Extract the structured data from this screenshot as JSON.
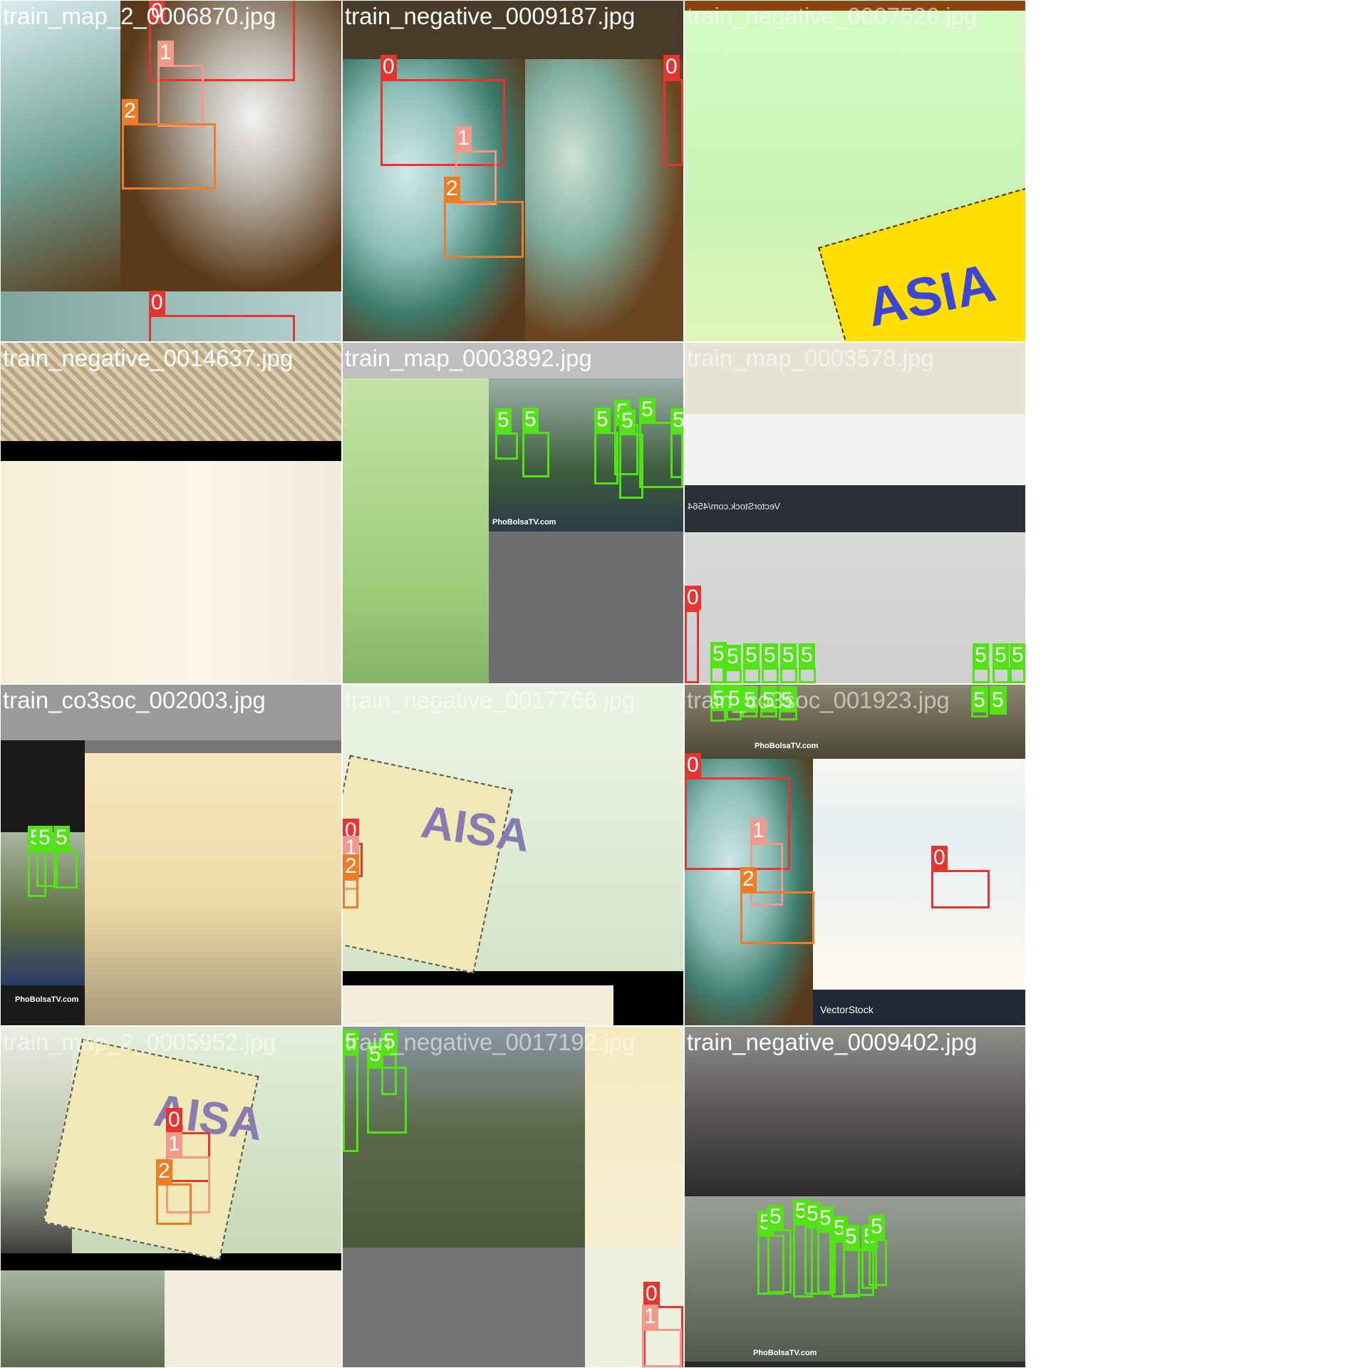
{
  "class_colors": {
    "0": "#e8342e",
    "1": "#f3998c",
    "2": "#f07c25",
    "5": "#52e314"
  },
  "tiles": [
    {
      "filename": "train_map_2_0006870.jpg",
      "boxes": [
        {
          "label": "0"
        },
        {
          "label": "1"
        },
        {
          "label": "2"
        },
        {
          "label": "0"
        }
      ]
    },
    {
      "filename": "train_negative_0009187.jpg",
      "boxes": [
        {
          "label": "0"
        },
        {
          "label": "1"
        },
        {
          "label": "2"
        },
        {
          "label": "0"
        }
      ]
    },
    {
      "filename": "train_negative_0007526.jpg",
      "texts": {
        "sign": "ASIA"
      },
      "boxes": []
    },
    {
      "filename": "train_negative_0014637.jpg",
      "boxes": []
    },
    {
      "filename": "train_map_0003892.jpg",
      "texts": {
        "watermark": "PhoBolsaTV.com"
      },
      "boxes": [
        {
          "label": "5"
        },
        {
          "label": "5"
        },
        {
          "label": "5"
        },
        {
          "label": "5"
        },
        {
          "label": "5"
        },
        {
          "label": "5"
        },
        {
          "label": "5"
        }
      ]
    },
    {
      "filename": "train_map_0003578.jpg",
      "texts": {
        "banner": "VectorStock.com/4564"
      },
      "boxes": [
        {
          "label": "0"
        },
        {
          "label": "5"
        },
        {
          "label": "5"
        },
        {
          "label": "5"
        },
        {
          "label": "5"
        },
        {
          "label": "5"
        },
        {
          "label": "5"
        },
        {
          "label": "5"
        },
        {
          "label": "5"
        },
        {
          "label": "5"
        }
      ]
    },
    {
      "filename": "train_co3soc_002003.jpg",
      "texts": {
        "watermark": "PhoBolsaTV.com"
      },
      "boxes": [
        {
          "label": "5"
        },
        {
          "label": "5"
        },
        {
          "label": "5"
        }
      ]
    },
    {
      "filename": "train_negative_0017766.jpg",
      "texts": {
        "sign": "AISA"
      },
      "boxes": [
        {
          "label": "0"
        },
        {
          "label": "1"
        },
        {
          "label": "2"
        }
      ]
    },
    {
      "filename": "train_co3soc_001923.jpg",
      "texts": {
        "watermark": "PhoBolsaTV.com",
        "vectorstock": "VectorStock"
      },
      "boxes": [
        {
          "label": "5"
        },
        {
          "label": "5"
        },
        {
          "label": "5"
        },
        {
          "label": "5"
        },
        {
          "label": "5"
        },
        {
          "label": "5"
        },
        {
          "label": "5"
        },
        {
          "label": "0"
        },
        {
          "label": "1"
        },
        {
          "label": "2"
        },
        {
          "label": "0"
        }
      ]
    },
    {
      "filename": "train_map_2_0005952.jpg",
      "texts": {
        "sign": "AISA"
      },
      "boxes": [
        {
          "label": "0"
        },
        {
          "label": "1"
        },
        {
          "label": "2"
        }
      ]
    },
    {
      "filename": "train_negative_0017192.jpg",
      "boxes": [
        {
          "label": "5"
        },
        {
          "label": "5"
        },
        {
          "label": "5"
        },
        {
          "label": "0"
        },
        {
          "label": "1"
        }
      ]
    },
    {
      "filename": "train_negative_0009402.jpg",
      "texts": {
        "watermark": "PhoBolsaTV.com"
      },
      "boxes": [
        {
          "label": "5"
        },
        {
          "label": "5"
        },
        {
          "label": "5"
        },
        {
          "label": "5"
        },
        {
          "label": "5"
        },
        {
          "label": "5"
        },
        {
          "label": "5"
        },
        {
          "label": "5"
        },
        {
          "label": "5"
        }
      ]
    }
  ]
}
